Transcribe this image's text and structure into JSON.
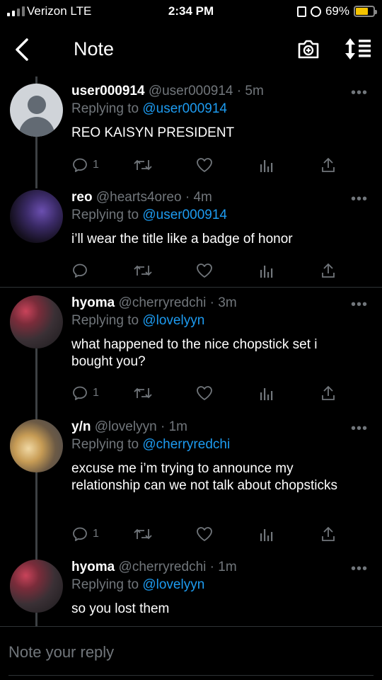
{
  "status_bar": {
    "carrier": "Verizon  LTE",
    "time": "2:34 PM",
    "battery_percent": "69%",
    "battery_level": 0.69,
    "battery_color": "#f5c400"
  },
  "header": {
    "back_icon": "chevron-left-icon",
    "title": "Note",
    "camera_icon": "camera-plus-icon",
    "sort_icon": "sort-list-icon"
  },
  "colors": {
    "background": "#000000",
    "text": "#ffffff",
    "muted": "#71767b",
    "link": "#1d9bf0",
    "divider": "#2f3336"
  },
  "posts": [
    {
      "name": "user000914",
      "handle": "@user000914",
      "time": "5m",
      "reply_label": "Replying to",
      "reply_to": "@user000914",
      "text": "REO KAISYN PRESIDENT",
      "reply_count": "1",
      "more": "•••"
    },
    {
      "name": "reo",
      "handle": "@hearts4oreo",
      "time": "4m",
      "reply_label": "Replying to",
      "reply_to": "@user000914",
      "text": "i’ll wear the title like a badge of honor",
      "reply_count": "",
      "more": "•••"
    },
    {
      "name": "hyoma",
      "handle": "@cherryredchi",
      "time": "3m",
      "reply_label": "Replying to",
      "reply_to": "@lovelyyn",
      "text": "what happened to the nice chopstick set i bought you?",
      "reply_count": "1",
      "more": "•••"
    },
    {
      "name": "y/n",
      "handle": "@lovelyyn",
      "time": "1m",
      "reply_label": "Replying to",
      "reply_to": "@cherryredchi",
      "text": "excuse me i’m trying to announce my relationship can we not talk about chopsticks",
      "reply_count": "1",
      "more": "•••"
    },
    {
      "name": "hyoma",
      "handle": "@cherryredchi",
      "time": "1m",
      "reply_label": "Replying to",
      "reply_to": "@lovelyyn",
      "text": "so you lost them",
      "reply_count": "",
      "more": "•••"
    }
  ],
  "reply_bar": {
    "placeholder": "Note your reply"
  }
}
